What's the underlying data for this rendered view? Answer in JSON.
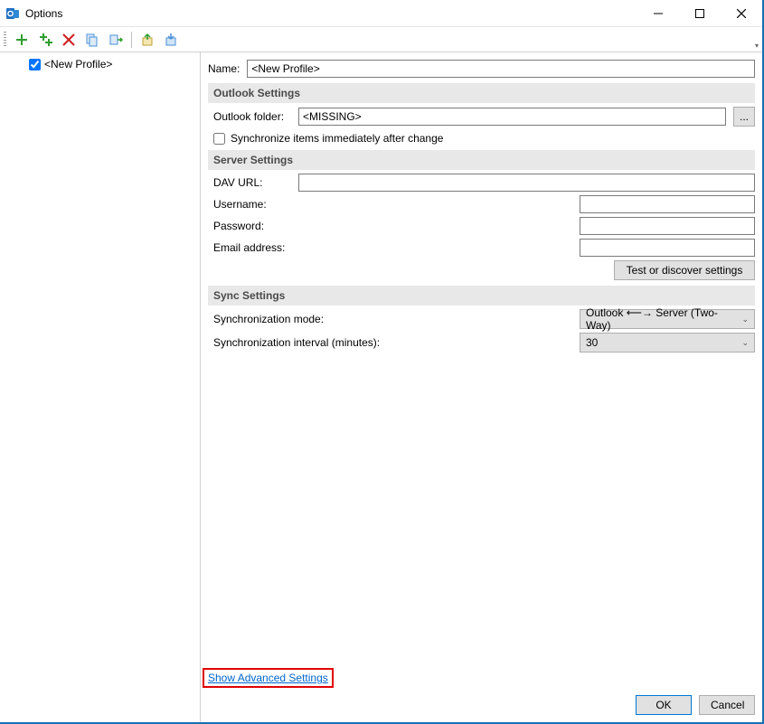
{
  "window": {
    "title": "Options"
  },
  "tree": {
    "profile_label": "<New Profile>"
  },
  "form": {
    "name_label": "Name:",
    "name_value": "<New Profile>",
    "outlook_section": "Outlook Settings",
    "outlook_folder_label": "Outlook folder:",
    "outlook_folder_value": "<MISSING>",
    "browse_btn": "...",
    "sync_immediate": "Synchronize items immediately after change",
    "server_section": "Server Settings",
    "dav_url_label": "DAV URL:",
    "dav_url_value": "",
    "username_label": "Username:",
    "username_value": "",
    "password_label": "Password:",
    "password_value": "",
    "email_label": "Email address:",
    "email_value": "",
    "test_btn": "Test or discover settings",
    "sync_section": "Sync Settings",
    "sync_mode_label": "Synchronization mode:",
    "sync_mode_value": "Outlook ⟵→ Server (Two-Way)",
    "sync_interval_label": "Synchronization interval (minutes):",
    "sync_interval_value": "30",
    "advanced_link": "Show Advanced Settings",
    "ok": "OK",
    "cancel": "Cancel"
  }
}
